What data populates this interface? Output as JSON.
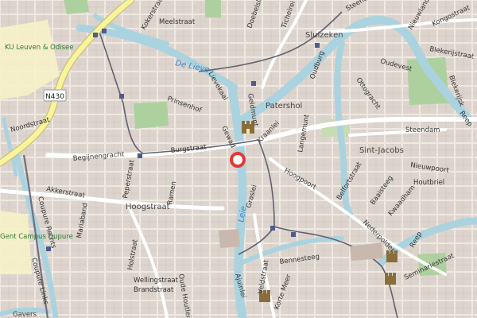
{
  "map": {
    "colors": {
      "land": "#efe9e1",
      "block": "#d9d0c9",
      "water": "#aad3df",
      "park": "#add19e",
      "campus": "#ffffe5",
      "highway": "#f9f49c",
      "highway_casing": "#c7c179",
      "rail": "#707080",
      "marker": "#e53935"
    },
    "labels": {
      "ku_leuven": "KU Leuven & Odisee",
      "gent_campus": "Gent Campus Dupure",
      "n430": "N430",
      "meelstraat": "Meelstraat",
      "kokerstraat": "Kokerstraat",
      "doebelslot": "Doebelslot",
      "tichelrei": "Tichelrei",
      "sluizeken": "Sluizeken",
      "steendam_top": "Steendam",
      "nieuwland": "Nieuwland",
      "kongostraat": "Kongostraat",
      "oudevest": "Oudevest",
      "blekerijstraat": "Blekerijstraat",
      "lieve": "De Lieve",
      "lievekaai": "Lievekaai",
      "geldmunt": "Geldmunt",
      "patershol": "Patershol",
      "oudburg": "Oudburg",
      "ottogracht": "Ottogracht",
      "blekerijsk": "Blekerijsk",
      "prinsenhof": "Prinsenhof",
      "noordstraat": "Noordstraat",
      "burgstraat": "Burgstraat",
      "gewad": "Gewad",
      "kraanlei": "Kraanlei",
      "steendam": "Steendam",
      "reep": "Reep",
      "beginengracht": "Begijnengracht",
      "langemunt": "Langemunt",
      "sint_jacobs": "Sint-Jacobs",
      "nieuwpoort": "Nieuwpoort",
      "houtbriel": "Houtbriel",
      "akkerstraat": "Akkerstraat",
      "peperstraat": "Peperstraat",
      "hoogpoort": "Hoogpoort",
      "belfortstraat": "Belfortstraat",
      "baaisteeg": "Baaisteeg",
      "kwaadham": "Kwaadham",
      "hoogstraat": "Hoogstraat",
      "ramen": "Ramen",
      "graslei": "Graslei",
      "leie": "Leie",
      "nederpolder": "Nederpolder",
      "mariaband": "Mariaband",
      "coupure_rechts": "Coupure Rechts",
      "holstraat": "Holstraat",
      "bennesteeg": "Bennesteeg",
      "wellingstraat": "Wellingstraat",
      "brandstraat": "Brandstraat",
      "oude_houtlei": "Oude Houtlei",
      "veldstraat": "Veldstraat",
      "korte_meer": "Korte Meer",
      "ajuinlei": "Ajuinlei",
      "seminariestraat": "Seminariestraat",
      "coupure_links": "Coupure Links",
      "gavers": "Gavers"
    }
  }
}
